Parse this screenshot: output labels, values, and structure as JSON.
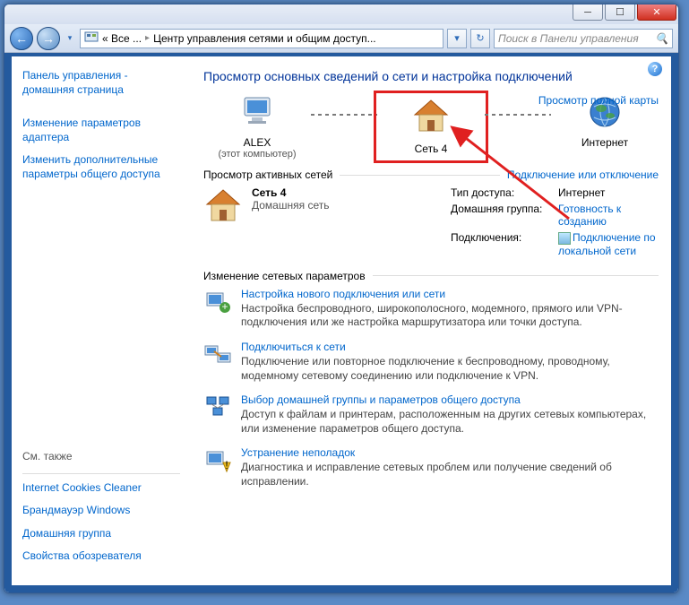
{
  "window": {
    "breadcrumb_prefix": "« Все ...",
    "breadcrumb_current": "Центр управления сетями и общим доступ...",
    "search_placeholder": "Поиск в Панели управления"
  },
  "sidebar": {
    "home": "Панель управления - домашняя страница",
    "adapter": "Изменение параметров адаптера",
    "sharing": "Изменить дополнительные параметры общего доступа",
    "see_also_label": "См. также",
    "links": {
      "cookies": "Internet Cookies Cleaner",
      "firewall": "Брандмауэр Windows",
      "homegroup": "Домашняя группа",
      "browser": "Свойства обозревателя"
    }
  },
  "main": {
    "title": "Просмотр основных сведений о сети и настройка подключений",
    "full_map": "Просмотр полной карты",
    "nodes": {
      "pc_name": "ALEX",
      "pc_sub": "(этот компьютер)",
      "net_name": "Сеть  4",
      "inet": "Интернет"
    },
    "active_header": "Просмотр активных сетей",
    "active_right_link": "Подключение или отключение",
    "active_net": {
      "name": "Сеть  4",
      "type": "Домашняя сеть",
      "kv": {
        "access_k": "Тип доступа:",
        "access_v": "Интернет",
        "hg_k": "Домашняя группа:",
        "hg_v": "Готовность к созданию",
        "conn_k": "Подключения:",
        "conn_v": "Подключение по локальной сети"
      }
    },
    "settings_header": "Изменение сетевых параметров",
    "tasks": [
      {
        "title": "Настройка нового подключения или сети",
        "desc": "Настройка беспроводного, широкополосного, модемного, прямого или VPN-подключения или же настройка маршрутизатора или точки доступа."
      },
      {
        "title": "Подключиться к сети",
        "desc": "Подключение или повторное подключение к беспроводному, проводному, модемному сетевому соединению или подключение к VPN."
      },
      {
        "title": "Выбор домашней группы и параметров общего доступа",
        "desc": "Доступ к файлам и принтерам, расположенным на других сетевых компьютерах, или изменение параметров общего доступа."
      },
      {
        "title": "Устранение неполадок",
        "desc": "Диагностика и исправление сетевых проблем или получение сведений об исправлении."
      }
    ]
  }
}
